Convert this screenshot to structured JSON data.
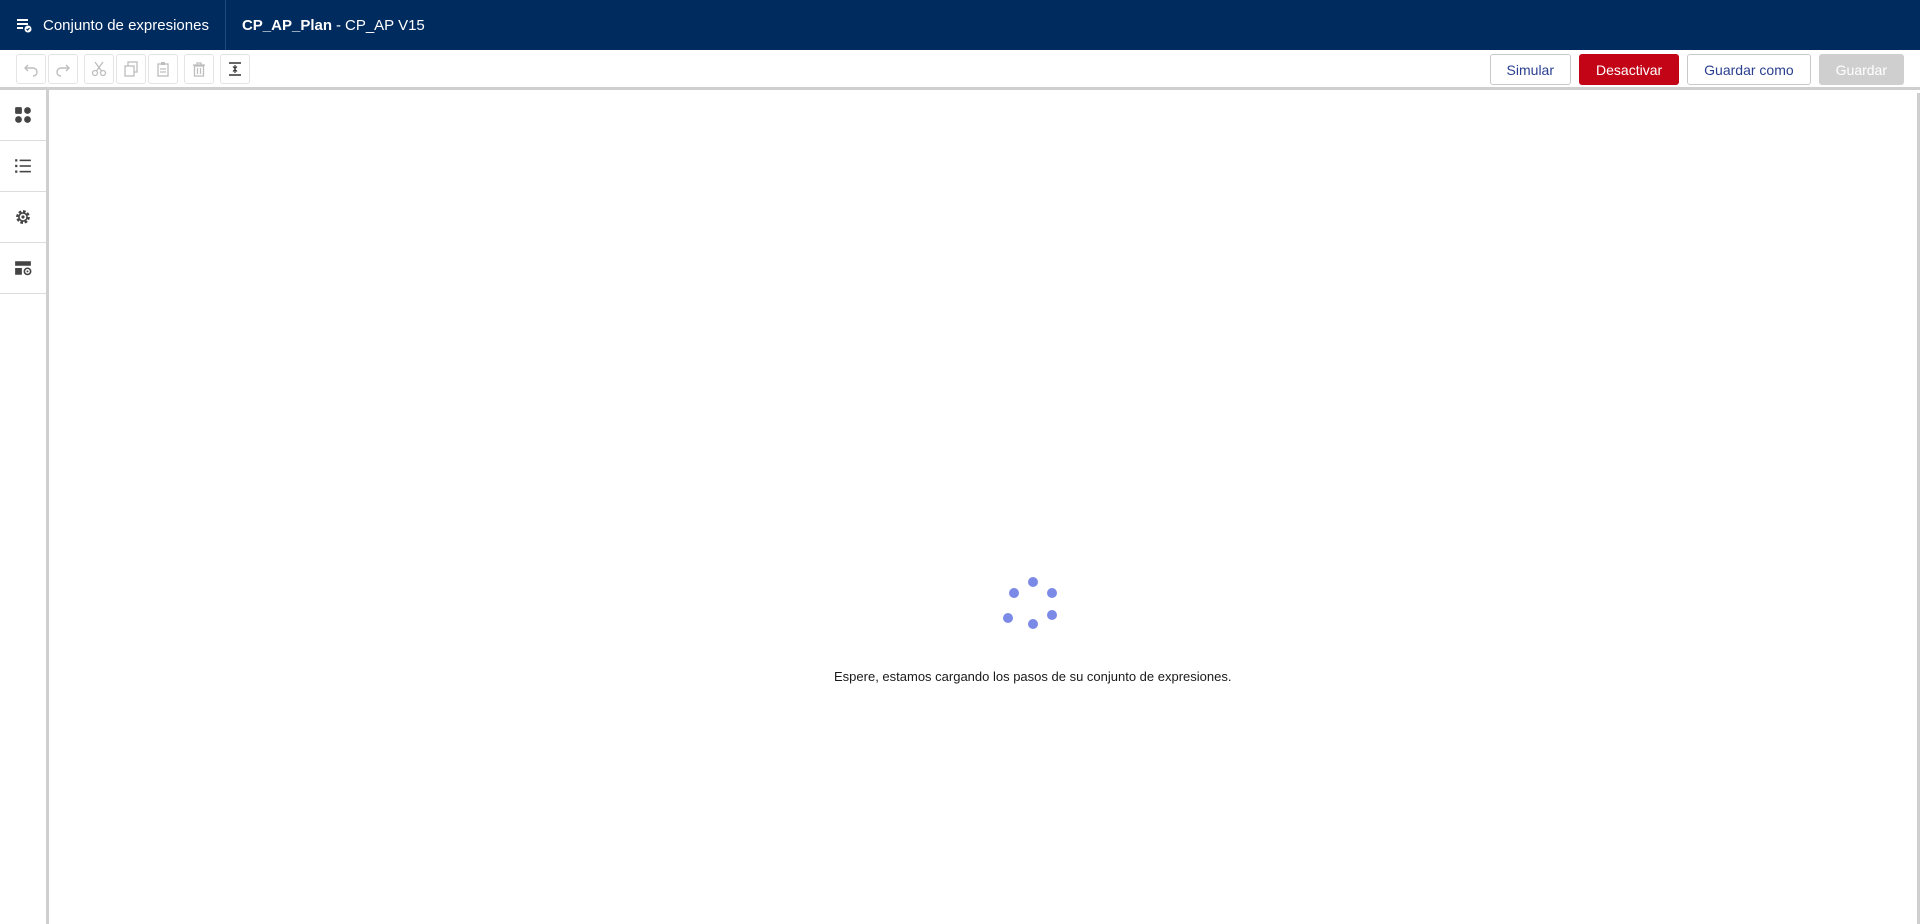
{
  "topbar": {
    "app_icon": "expression-set-icon",
    "app_title": "Conjunto de expresiones",
    "doc_name": "CP_AP_Plan",
    "doc_separator": "-",
    "doc_version": "CP_AP V15"
  },
  "toolbar": {
    "tools": [
      "undo-icon",
      "redo-icon",
      "cut-icon",
      "copy-icon",
      "paste-icon",
      "delete-icon",
      "collapse-icon"
    ]
  },
  "actions": {
    "simulate": "Simular",
    "deactivate": "Desactivar",
    "save_as": "Guardar como",
    "save": "Guardar"
  },
  "sidenav": {
    "items": [
      "elements-icon",
      "list-icon",
      "settings-icon",
      "properties-icon"
    ]
  },
  "canvas": {
    "loading_text": "Espere, estamos cargando los pasos de su conjunto de expresiones."
  },
  "colors": {
    "header": "#002b5f",
    "danger": "#c20416",
    "accent": "#2a3f8f",
    "spinner": "#7b8ae6"
  }
}
